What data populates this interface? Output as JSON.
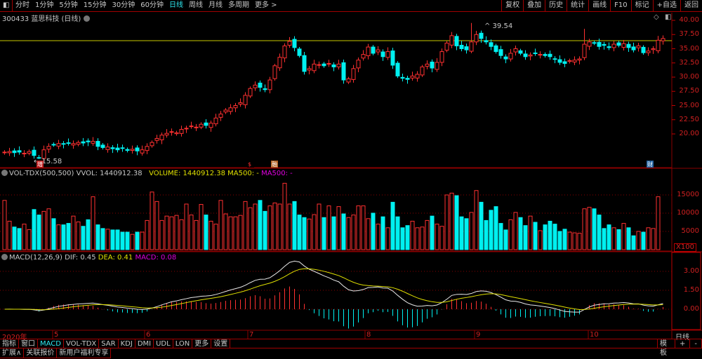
{
  "toolbar": {
    "periods": [
      "分时",
      "1分钟",
      "5分钟",
      "15分钟",
      "30分钟",
      "60分钟",
      "日线",
      "周线",
      "月线",
      "多周期",
      "更多 >"
    ],
    "active": "日线",
    "right_buttons": [
      "复权",
      "叠加",
      "历史",
      "统计",
      "画线",
      "F10",
      "标记",
      "+自选",
      "返回"
    ]
  },
  "title": "300433 蓝思科技 (日线)",
  "price_axis": [
    "40.00",
    "37.50",
    "35.00",
    "32.50",
    "30.00",
    "27.50",
    "25.00",
    "22.50",
    "20.00"
  ],
  "price_ticks": [
    40,
    37.5,
    35,
    32.5,
    30,
    27.5,
    25,
    22.5,
    20
  ],
  "annotations": {
    "high": "39.54",
    "low": "15.58"
  },
  "event_markers": [
    "增",
    "$",
    "融",
    "财"
  ],
  "volume": {
    "header_name": "VOL-TDX(500,500)",
    "vvol": "VVOL: 1440912.38",
    "volume": "VOLUME: 1440912.38",
    "ma1": "MA500: -",
    "ma2": "MA500: -",
    "axis": [
      "15000",
      "10000",
      "5000"
    ],
    "unit": "X100"
  },
  "macd": {
    "header_name": "MACD(12,26,9)",
    "dif": "DIF: 0.45",
    "dea": "DEA: 0.41",
    "macd": "MACD: 0.08",
    "axis": [
      "3.00",
      "1.50",
      "0.00"
    ]
  },
  "dates": [
    "2020年",
    "5",
    "6",
    "7",
    "8",
    "9",
    "10"
  ],
  "period_label": "日线",
  "indicator_tabs": [
    "指标",
    "窗口",
    "MACD",
    "VOL-TDX",
    "SAR",
    "KDJ",
    "DMI",
    "UDL",
    "LON",
    "更多",
    "设置"
  ],
  "active_tab": "MACD",
  "template_btn": "模板",
  "plus": "+",
  "minus": "-",
  "bottom_tabs": [
    "扩展∧",
    "关联报价",
    "新用户福利专享"
  ],
  "colors": {
    "up": "#ff3030",
    "down": "#00f0f0",
    "accent": "#2ee8f0",
    "dea": "#e0e000",
    "macd": "#e000e0",
    "grid": "#8a0000"
  },
  "chart_data": {
    "type": "candlestick",
    "closes": [
      16.8,
      16.9,
      16.7,
      16.8,
      16.6,
      16.9,
      16.2,
      15.8,
      17.2,
      17.8,
      18.1,
      18.3,
      18.2,
      18.4,
      18.3,
      18.5,
      18.4,
      18.6,
      18.7,
      17.8,
      17.6,
      17.7,
      17.4,
      17.2,
      17.5,
      17.1,
      17.3,
      17.0,
      17.2,
      17.8,
      18.5,
      19.2,
      19.8,
      20.1,
      20.4,
      20.2,
      20.8,
      21.0,
      21.4,
      21.2,
      21.7,
      21.5,
      21.9,
      22.8,
      23.5,
      24.2,
      24.6,
      25.0,
      25.5,
      26.8,
      28.0,
      28.6,
      28.2,
      27.8,
      29.5,
      32.0,
      33.5,
      35.5,
      36.3,
      35.2,
      33.8,
      31.0,
      31.5,
      32.3,
      32.2,
      32.0,
      32.4,
      31.8,
      32.3,
      29.5,
      29.7,
      31.5,
      33.0,
      34.0,
      35.3,
      34.2,
      34.8,
      33.6,
      34.5,
      32.1,
      30.2,
      29.8,
      29.6,
      30.2,
      30.5,
      31.8,
      32.3,
      31.6,
      32.6,
      34.5,
      36.0,
      37.3,
      35.5,
      35.0,
      34.8,
      36.2,
      37.5,
      36.8,
      36.2,
      35.4,
      34.5,
      33.8,
      33.2,
      34.2,
      35.0,
      34.2,
      33.6,
      33.9,
      34.2,
      34.0,
      33.8,
      33.6,
      33.2,
      32.6,
      32.4,
      32.9,
      33.0,
      33.2,
      35.8,
      36.2,
      36.0,
      35.4,
      35.6,
      35.2,
      35.8,
      35.6,
      35.9,
      35.2,
      34.8,
      35.5,
      34.3,
      34.6,
      35.0,
      36.5,
      36.8
    ],
    "volumes": [
      13500,
      7800,
      6200,
      5800,
      7000,
      5500,
      11000,
      9500,
      10500,
      11200,
      8500,
      6800,
      6800,
      7200,
      9200,
      7600,
      6400,
      8200,
      14500,
      6800,
      5800,
      5600,
      5400,
      5400,
      4800,
      4800,
      4200,
      4800,
      4800,
      8000,
      15800,
      13200,
      8000,
      9200,
      9000,
      9400,
      8200,
      12500,
      9500,
      8000,
      12400,
      9500,
      7800,
      7000,
      13500,
      9800,
      9000,
      9000,
      9400,
      13200,
      11500,
      12500,
      13500,
      10500,
      12000,
      12800,
      12500,
      18200,
      12500,
      13200,
      9500,
      8800,
      8400,
      9600,
      12500,
      8800,
      12000,
      9000,
      11800,
      9800,
      8800,
      9500,
      12000,
      12000,
      8500,
      10000,
      7000,
      9000,
      6000,
      13000,
      9000,
      6000,
      6600,
      7800,
      6000,
      6200,
      8000,
      9200,
      7000,
      6400,
      15000,
      15500,
      14800,
      9000,
      8500,
      10200,
      16200,
      13000,
      8000,
      10800,
      11800,
      7200,
      5400,
      8200,
      10200,
      8800,
      6600,
      9200,
      7500,
      5200,
      6800,
      7800,
      7000,
      5000,
      5600,
      4800,
      4600,
      4500,
      11200,
      11600,
      11200,
      9500,
      5800,
      6800,
      6000,
      5500,
      7200,
      6000,
      3800,
      5000,
      4800,
      6000,
      5800,
      14500
    ],
    "high_label": 39.54,
    "low_label": 15.58,
    "ylim": [
      18,
      41
    ]
  }
}
